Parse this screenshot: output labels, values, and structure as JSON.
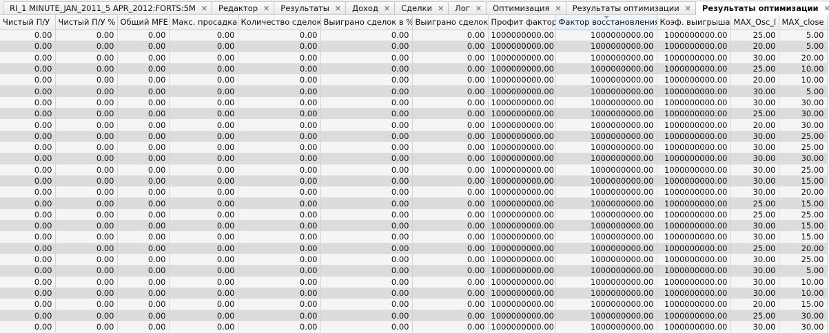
{
  "tabs": [
    {
      "label": "RI_1 MINUTE_JAN_2011_5 APR_2012:FORTS:5M",
      "active": false
    },
    {
      "label": "Редактор",
      "active": false
    },
    {
      "label": "Результаты",
      "active": false
    },
    {
      "label": "Доход",
      "active": false
    },
    {
      "label": "Сделки",
      "active": false
    },
    {
      "label": "Лог",
      "active": false
    },
    {
      "label": "Оптимизация",
      "active": false
    },
    {
      "label": "Результаты оптимизации",
      "active": false
    },
    {
      "label": "Результаты оптимизации",
      "active": true
    }
  ],
  "close_glyph": "✕",
  "columns": [
    "Чистый П/У",
    "Чистый П/У %",
    "Общий MFE",
    "Макс. просадка",
    "Количество сделок",
    "Выиграно сделок в %",
    "Выиграно сделок",
    "Профит фактор",
    "Фактор восстановления",
    "Коэф. выигрыша",
    "MAX_Osc_l",
    "MAX_close"
  ],
  "sorted_column": 8,
  "rows": [
    [
      "0.00",
      "0.00",
      "0.00",
      "0.00",
      "0.00",
      "0.00",
      "0.00",
      "1000000000.00",
      "1000000000.00",
      "1000000000.00",
      "25.00",
      "5.00"
    ],
    [
      "0.00",
      "0.00",
      "0.00",
      "0.00",
      "0.00",
      "0.00",
      "0.00",
      "1000000000.00",
      "1000000000.00",
      "1000000000.00",
      "20.00",
      "5.00"
    ],
    [
      "0.00",
      "0.00",
      "0.00",
      "0.00",
      "0.00",
      "0.00",
      "0.00",
      "1000000000.00",
      "1000000000.00",
      "1000000000.00",
      "30.00",
      "20.00"
    ],
    [
      "0.00",
      "0.00",
      "0.00",
      "0.00",
      "0.00",
      "0.00",
      "0.00",
      "1000000000.00",
      "1000000000.00",
      "1000000000.00",
      "25.00",
      "10.00"
    ],
    [
      "0.00",
      "0.00",
      "0.00",
      "0.00",
      "0.00",
      "0.00",
      "0.00",
      "1000000000.00",
      "1000000000.00",
      "1000000000.00",
      "20.00",
      "10.00"
    ],
    [
      "0.00",
      "0.00",
      "0.00",
      "0.00",
      "0.00",
      "0.00",
      "0.00",
      "1000000000.00",
      "1000000000.00",
      "1000000000.00",
      "30.00",
      "5.00"
    ],
    [
      "0.00",
      "0.00",
      "0.00",
      "0.00",
      "0.00",
      "0.00",
      "0.00",
      "1000000000.00",
      "1000000000.00",
      "1000000000.00",
      "30.00",
      "30.00"
    ],
    [
      "0.00",
      "0.00",
      "0.00",
      "0.00",
      "0.00",
      "0.00",
      "0.00",
      "1000000000.00",
      "1000000000.00",
      "1000000000.00",
      "25.00",
      "30.00"
    ],
    [
      "0.00",
      "0.00",
      "0.00",
      "0.00",
      "0.00",
      "0.00",
      "0.00",
      "1000000000.00",
      "1000000000.00",
      "1000000000.00",
      "20.00",
      "30.00"
    ],
    [
      "0.00",
      "0.00",
      "0.00",
      "0.00",
      "0.00",
      "0.00",
      "0.00",
      "1000000000.00",
      "1000000000.00",
      "1000000000.00",
      "30.00",
      "25.00"
    ],
    [
      "0.00",
      "0.00",
      "0.00",
      "0.00",
      "0.00",
      "0.00",
      "0.00",
      "1000000000.00",
      "1000000000.00",
      "1000000000.00",
      "30.00",
      "25.00"
    ],
    [
      "0.00",
      "0.00",
      "0.00",
      "0.00",
      "0.00",
      "0.00",
      "0.00",
      "1000000000.00",
      "1000000000.00",
      "1000000000.00",
      "30.00",
      "30.00"
    ],
    [
      "0.00",
      "0.00",
      "0.00",
      "0.00",
      "0.00",
      "0.00",
      "0.00",
      "1000000000.00",
      "1000000000.00",
      "1000000000.00",
      "30.00",
      "25.00"
    ],
    [
      "0.00",
      "0.00",
      "0.00",
      "0.00",
      "0.00",
      "0.00",
      "0.00",
      "1000000000.00",
      "1000000000.00",
      "1000000000.00",
      "30.00",
      "15.00"
    ],
    [
      "0.00",
      "0.00",
      "0.00",
      "0.00",
      "0.00",
      "0.00",
      "0.00",
      "1000000000.00",
      "1000000000.00",
      "1000000000.00",
      "30.00",
      "20.00"
    ],
    [
      "0.00",
      "0.00",
      "0.00",
      "0.00",
      "0.00",
      "0.00",
      "0.00",
      "1000000000.00",
      "1000000000.00",
      "1000000000.00",
      "25.00",
      "15.00"
    ],
    [
      "0.00",
      "0.00",
      "0.00",
      "0.00",
      "0.00",
      "0.00",
      "0.00",
      "1000000000.00",
      "1000000000.00",
      "1000000000.00",
      "25.00",
      "25.00"
    ],
    [
      "0.00",
      "0.00",
      "0.00",
      "0.00",
      "0.00",
      "0.00",
      "0.00",
      "1000000000.00",
      "1000000000.00",
      "1000000000.00",
      "30.00",
      "15.00"
    ],
    [
      "0.00",
      "0.00",
      "0.00",
      "0.00",
      "0.00",
      "0.00",
      "0.00",
      "1000000000.00",
      "1000000000.00",
      "1000000000.00",
      "30.00",
      "15.00"
    ],
    [
      "0.00",
      "0.00",
      "0.00",
      "0.00",
      "0.00",
      "0.00",
      "0.00",
      "1000000000.00",
      "1000000000.00",
      "1000000000.00",
      "25.00",
      "20.00"
    ],
    [
      "0.00",
      "0.00",
      "0.00",
      "0.00",
      "0.00",
      "0.00",
      "0.00",
      "1000000000.00",
      "1000000000.00",
      "1000000000.00",
      "30.00",
      "25.00"
    ],
    [
      "0.00",
      "0.00",
      "0.00",
      "0.00",
      "0.00",
      "0.00",
      "0.00",
      "1000000000.00",
      "1000000000.00",
      "1000000000.00",
      "30.00",
      "5.00"
    ],
    [
      "0.00",
      "0.00",
      "0.00",
      "0.00",
      "0.00",
      "0.00",
      "0.00",
      "1000000000.00",
      "1000000000.00",
      "1000000000.00",
      "30.00",
      "10.00"
    ],
    [
      "0.00",
      "0.00",
      "0.00",
      "0.00",
      "0.00",
      "0.00",
      "0.00",
      "1000000000.00",
      "1000000000.00",
      "1000000000.00",
      "30.00",
      "10.00"
    ],
    [
      "0.00",
      "0.00",
      "0.00",
      "0.00",
      "0.00",
      "0.00",
      "0.00",
      "1000000000.00",
      "1000000000.00",
      "1000000000.00",
      "20.00",
      "15.00"
    ],
    [
      "0.00",
      "0.00",
      "0.00",
      "0.00",
      "0.00",
      "0.00",
      "0.00",
      "1000000000.00",
      "1000000000.00",
      "1000000000.00",
      "25.00",
      "30.00"
    ],
    [
      "0.00",
      "0.00",
      "0.00",
      "0.00",
      "0.00",
      "0.00",
      "0.00",
      "1000000000.00",
      "1000000000.00",
      "1000000000.00",
      "30.00",
      "30.00"
    ]
  ]
}
